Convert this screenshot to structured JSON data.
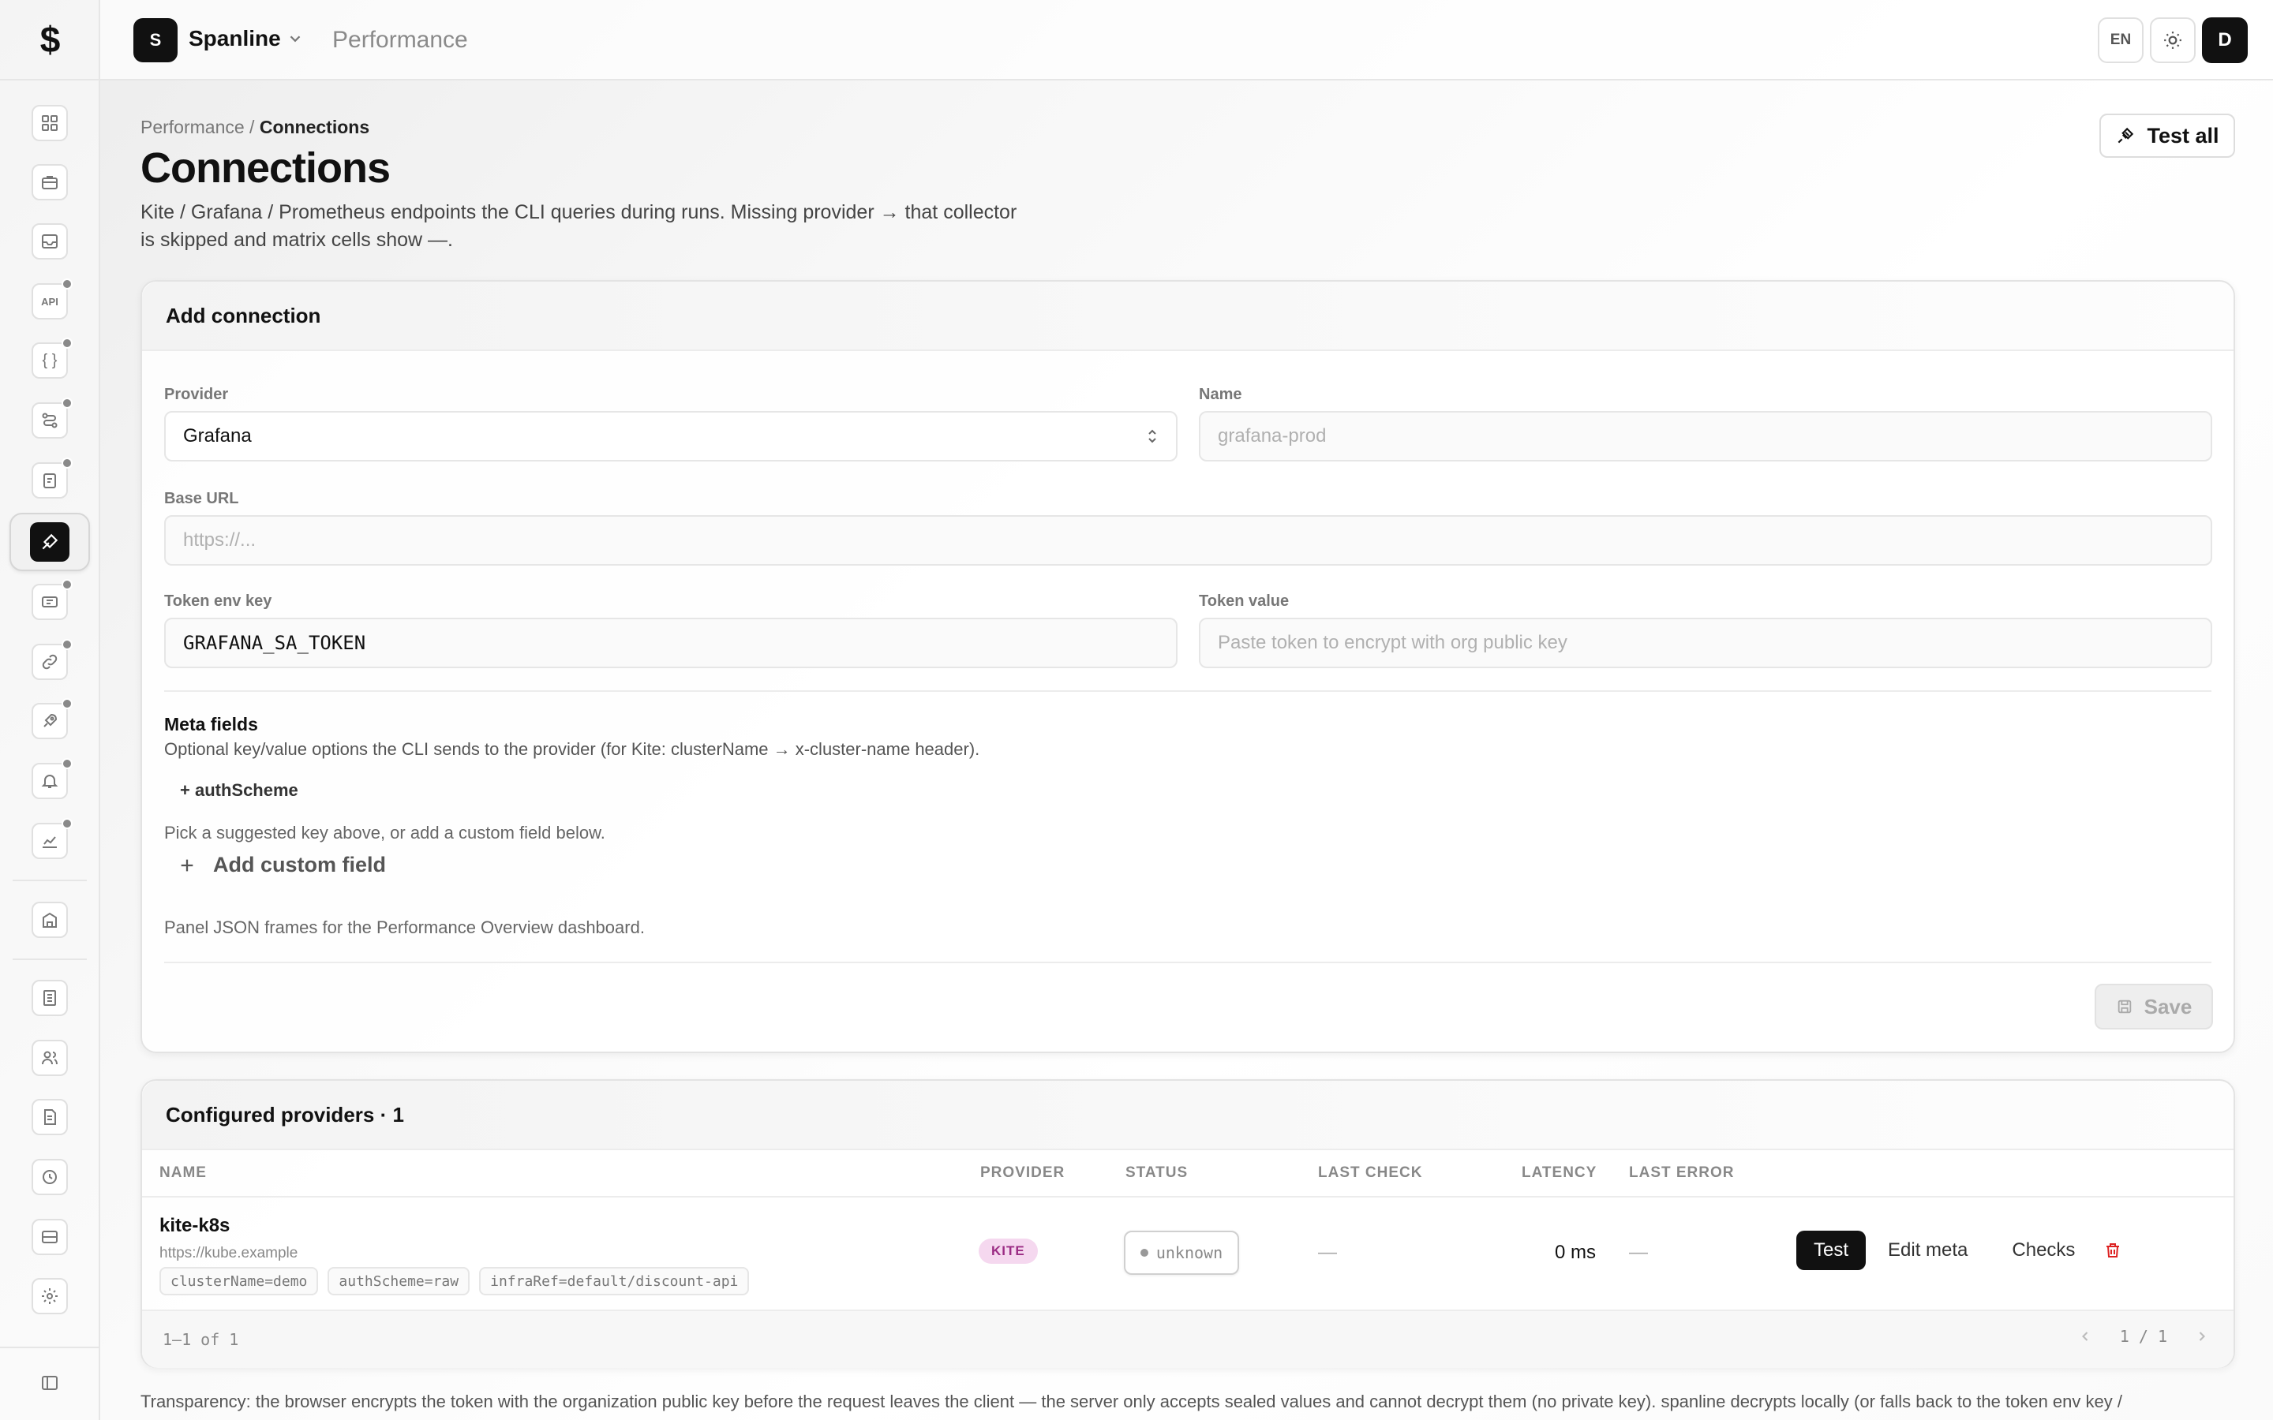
{
  "app": {
    "logo": "$",
    "workspace_initial": "S",
    "workspace_name": "Spanline",
    "section": "Performance"
  },
  "topbar": {
    "lang": "EN",
    "user_initial": "D"
  },
  "breadcrumb": {
    "parent": "Performance",
    "sep": " / ",
    "current": "Connections"
  },
  "page": {
    "title": "Connections",
    "description": "Kite / Grafana / Prometheus endpoints the CLI queries during runs. Missing provider → that collector is skipped and matrix cells show —.",
    "test_all_label": "Test all"
  },
  "add_connection": {
    "title": "Add connection",
    "provider_label": "Provider",
    "provider_value": "Grafana",
    "name_label": "Name",
    "name_placeholder": "grafana-prod",
    "base_url_label": "Base URL",
    "base_url_placeholder": "https://...",
    "token_env_label": "Token env key",
    "token_env_value": "GRAFANA_SA_TOKEN",
    "token_value_label": "Token value",
    "token_value_placeholder": "Paste token to encrypt with org public key",
    "meta_title": "Meta fields",
    "meta_desc": "Optional key/value options the CLI sends to the provider (for Kite: clusterName → x-cluster-name header).",
    "meta_suggestion": "+ authScheme",
    "meta_hint": "Pick a suggested key above, or add a custom field below.",
    "add_custom_label": "Add custom field",
    "panel_note": "Panel JSON frames for the Performance Overview dashboard.",
    "save_label": "Save"
  },
  "providers": {
    "title": "Configured providers · 1",
    "columns": {
      "name": "NAME",
      "provider": "PROVIDER",
      "status": "STATUS",
      "last_check": "LAST CHECK",
      "latency": "LATENCY",
      "last_error": "LAST ERROR"
    },
    "rows": [
      {
        "name": "kite-k8s",
        "url": "https://kube.example",
        "tags": [
          "clusterName=demo",
          "authScheme=raw",
          "infraRef=default/discount-api"
        ],
        "provider": "KITE",
        "status": "unknown",
        "last_check": "—",
        "latency": "0 ms",
        "last_error": "—",
        "actions": {
          "test": "Test",
          "edit_meta": "Edit meta",
          "checks": "Checks"
        }
      }
    ],
    "footer": {
      "count": "1–1 of 1",
      "page": "1 / 1"
    }
  },
  "transparency": "Transparency: the browser encrypts the token with the organization public key before the request leaves the client — the server only accepts sealed values and cannot decrypt them (no private key). spanline decrypts locally (or falls back to the token env key /",
  "icons": {
    "sidebar": [
      "dashboard-icon",
      "briefcase-icon",
      "inbox-icon",
      "api-icon",
      "braces-icon",
      "workflow-icon",
      "clipboard-icon",
      "performance-icon",
      "ticket-icon",
      "link-icon",
      "rocket-icon",
      "bell-icon",
      "chart-icon",
      "building-icon",
      "ledger-icon",
      "users-icon",
      "report-icon",
      "history-icon",
      "storage-icon",
      "settings-icon",
      "collapse-icon"
    ]
  }
}
